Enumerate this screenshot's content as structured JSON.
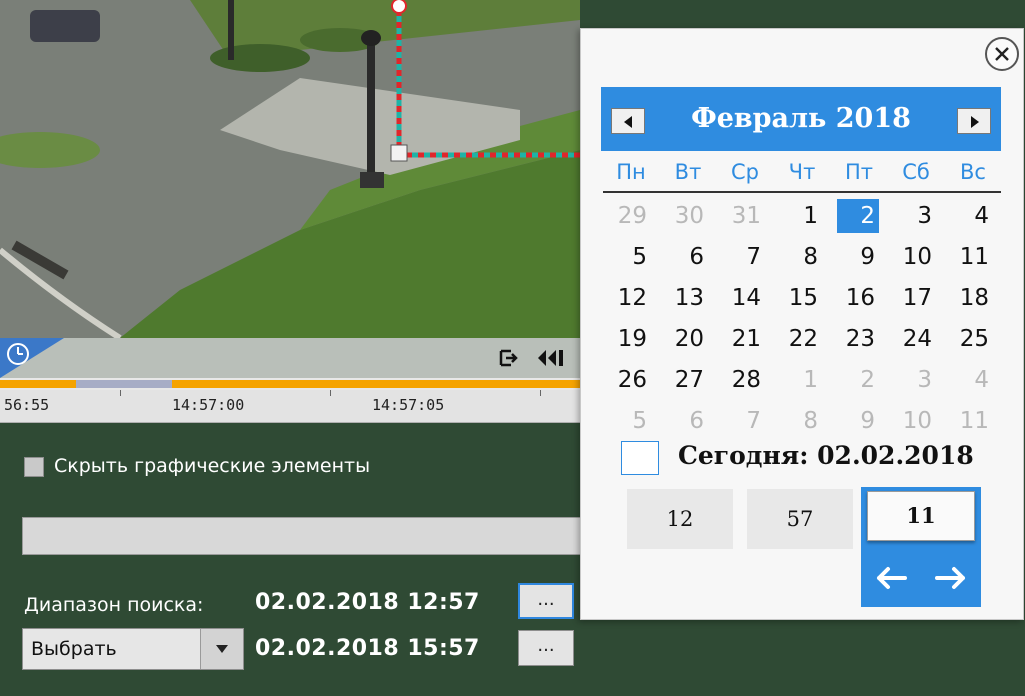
{
  "timeline": {
    "ticks": [
      "56:55",
      "14:57:00",
      "14:57:05"
    ],
    "colors": {
      "recorded": "#f5a300",
      "played": "#a7adc6"
    }
  },
  "panel": {
    "hide_graphics_label": "Скрыть графические элементы",
    "search_range_label": "Диапазон поиска:",
    "range_start": "02.02.2018  12:57",
    "range_end": "02.02.2018  15:57",
    "dots_label": "...",
    "select_value": "Выбрать"
  },
  "calendar": {
    "month_title": "Февраль 2018",
    "weekdays": [
      "Пн",
      "Вт",
      "Ср",
      "Чт",
      "Пт",
      "Сб",
      "Вс"
    ],
    "weeks": [
      [
        "29",
        "30",
        "31",
        "1",
        "2",
        "3",
        "4"
      ],
      [
        "5",
        "6",
        "7",
        "8",
        "9",
        "10",
        "11"
      ],
      [
        "12",
        "13",
        "14",
        "15",
        "16",
        "17",
        "18"
      ],
      [
        "19",
        "20",
        "21",
        "22",
        "23",
        "24",
        "25"
      ],
      [
        "26",
        "27",
        "28",
        "1",
        "2",
        "3",
        "4"
      ],
      [
        "5",
        "6",
        "7",
        "8",
        "9",
        "10",
        "11"
      ]
    ],
    "selected_day": "2",
    "today_label": "Сегодня: 02.02.2018",
    "hour": "12",
    "minute": "57",
    "second": "11",
    "accent_color": "#2f8ce0"
  }
}
